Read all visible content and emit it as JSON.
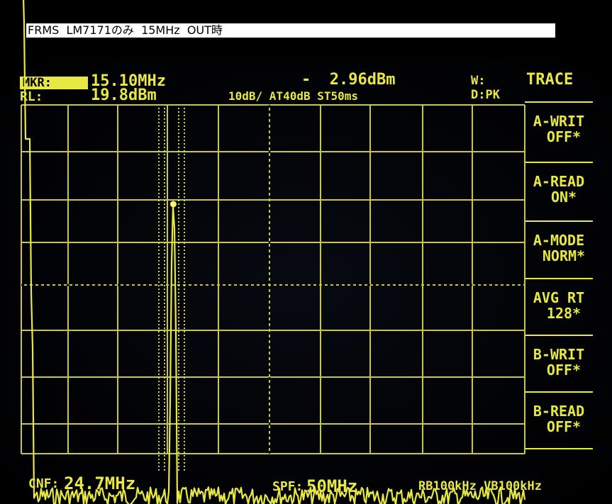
{
  "caption": "FRMS  LM7171のみ  15MHz  OUT時",
  "header": {
    "mkr_label": "MKR:",
    "mkr_freq": "15.10MHz",
    "mkr_level": "-  2.96dBm",
    "rl_label": "RL:",
    "rl_value": "19.8dBm",
    "scale_line": "10dB/ AT40dB ST50ms",
    "w_label": "W:",
    "d_label": "D:PK"
  },
  "softkeys": {
    "title": "TRACE",
    "items": [
      {
        "line1": "A-WRIT",
        "line2": "OFF*"
      },
      {
        "line1": "A-READ",
        "line2": "ON*"
      },
      {
        "line1": "A-MODE",
        "line2": "NORM*"
      },
      {
        "line1": "AVG RT",
        "line2": "128*"
      },
      {
        "line1": "B-WRIT",
        "line2": "OFF*"
      },
      {
        "line1": "B-READ",
        "line2": "OFF*"
      }
    ]
  },
  "footer": {
    "cnf_label": "CNF:",
    "cnf_value": "24.7MHz",
    "spf_label": "SPF:",
    "spf_value": "50MHz",
    "rbw_vbw": "RB100kHz VB100kHz"
  },
  "colors": {
    "trace": "#e8e845",
    "grid": "#c8c83a",
    "background": "#000000"
  },
  "chart_data": {
    "type": "line",
    "span_mhz": [
      0,
      50
    ],
    "ref_level_dbm": 19.8,
    "db_per_div": 10,
    "marker": {
      "freq_mhz": 15.1,
      "level_dbm": -2.96
    },
    "peaks": [
      {
        "freq_mhz": 0.3,
        "level_dbm": 12
      },
      {
        "freq_mhz": 15.1,
        "level_dbm": -2.96
      }
    ],
    "noise_floor_dbm": -70
  }
}
